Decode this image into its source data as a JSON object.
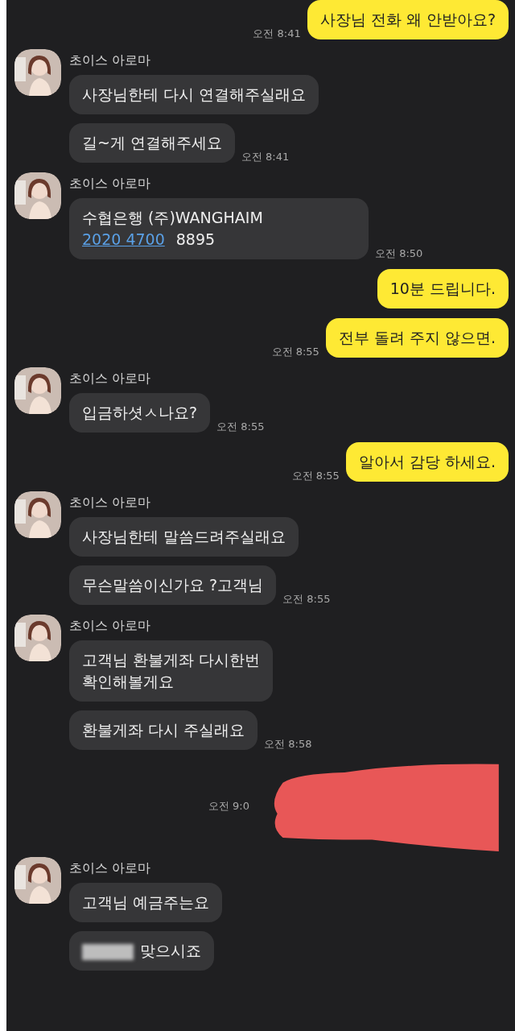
{
  "messages": [
    {
      "kind": "outgoing",
      "bubbles": [
        {
          "text": "사장님 전화 왜 안받아요?"
        }
      ],
      "time": "오전 8:41"
    },
    {
      "kind": "incoming",
      "sender": "초이스 아로마",
      "bubbles": [
        {
          "text": "사장님한테 다시 연결해주실래요"
        },
        {
          "text": "길~게 연결해주세요"
        }
      ],
      "time": "오전 8:41"
    },
    {
      "kind": "incoming",
      "sender": "초이스 아로마",
      "bubbles": [
        {
          "text": "수협은행 (주)WANGHAIM",
          "link": "2020 4700",
          "after": "8895"
        }
      ],
      "time": "오전 8:50"
    },
    {
      "kind": "outgoing",
      "bubbles": [
        {
          "text": "10분 드립니다."
        },
        {
          "text": "전부 돌려 주지 않으면."
        }
      ],
      "time": "오전 8:55"
    },
    {
      "kind": "incoming",
      "sender": "초이스 아로마",
      "bubbles": [
        {
          "text": "입금하셧ㅅ나요?"
        }
      ],
      "time": "오전 8:55"
    },
    {
      "kind": "outgoing",
      "bubbles": [
        {
          "text": "알아서 감당 하세요."
        }
      ],
      "time": "오전 8:55"
    },
    {
      "kind": "incoming",
      "sender": "초이스 아로마",
      "bubbles": [
        {
          "text": "사장님한테 말씀드려주실래요"
        },
        {
          "text": "무슨말씀이신가요 ?고객님"
        }
      ],
      "time": "오전 8:55"
    },
    {
      "kind": "incoming",
      "sender": "초이스 아로마",
      "bubbles": [
        {
          "text": "고객님 환불게좌 다시한번\n확인해볼게요"
        },
        {
          "text": "환불게좌 다시 주실래요"
        }
      ],
      "time": "오전 8:58"
    },
    {
      "kind": "outgoing",
      "redacted": true,
      "time": "오전 9:0"
    },
    {
      "kind": "incoming",
      "sender": "초이스 아로마",
      "bubbles": [
        {
          "text": "고객님 예금주는요"
        },
        {
          "text": "맞으시죠",
          "blurred_prefix": true
        }
      ]
    }
  ]
}
